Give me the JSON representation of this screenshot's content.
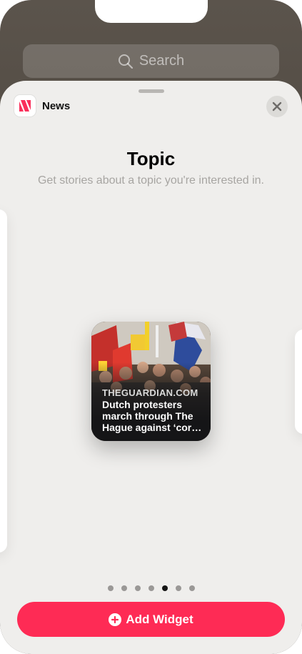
{
  "search": {
    "placeholder": "Search",
    "icon": "search-icon"
  },
  "sheet": {
    "app_name": "News",
    "title": "Topic",
    "subtitle": "Get stories about a topic you're interested in."
  },
  "widget": {
    "source": "THEGUARDIAN.COM",
    "headline": "Dutch protesters march through The Hague against ‘cor…"
  },
  "pager": {
    "count": 7,
    "active_index": 4
  },
  "add_button": {
    "label": "Add Widget"
  },
  "colors": {
    "accent": "#fe2b55",
    "sheet_bg": "#efeeec",
    "news_icon_red": "#fa2f5a"
  }
}
